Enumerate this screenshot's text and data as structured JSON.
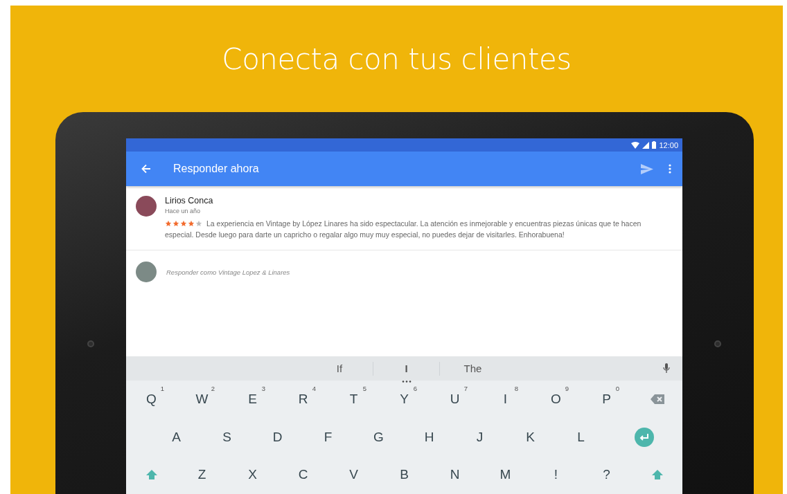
{
  "headline": "Conecta con tus clientes",
  "status_bar": {
    "time": "12:00"
  },
  "app_bar": {
    "title": "Responder ahora"
  },
  "review": {
    "author": "Lirios Conca",
    "date": "Hace un año",
    "stars": 4,
    "text": "La experiencia en Vintage by López Linares ha sido espectacular. La atención es inmejorable y encuentras piezas únicas que te hacen especial. Desde luego para darte un capricho o regalar algo muy muy especial, no puedes dejar de visitarles. Enhorabuena!"
  },
  "reply": {
    "placeholder": "Responder como Vintage Lopez & Linares"
  },
  "keyboard": {
    "suggestions": [
      {
        "label": "If",
        "selected": false
      },
      {
        "label": "I",
        "selected": true
      },
      {
        "label": "The",
        "selected": false
      }
    ],
    "rows": [
      [
        {
          "kind": "letter",
          "label": "Q",
          "hint": "1"
        },
        {
          "kind": "letter",
          "label": "W",
          "hint": "2"
        },
        {
          "kind": "letter",
          "label": "E",
          "hint": "3"
        },
        {
          "kind": "letter",
          "label": "R",
          "hint": "4"
        },
        {
          "kind": "letter",
          "label": "T",
          "hint": "5"
        },
        {
          "kind": "letter",
          "label": "Y",
          "hint": "6"
        },
        {
          "kind": "letter",
          "label": "U",
          "hint": "7"
        },
        {
          "kind": "letter",
          "label": "I",
          "hint": "8"
        },
        {
          "kind": "letter",
          "label": "O",
          "hint": "9"
        },
        {
          "kind": "letter",
          "label": "P",
          "hint": "0"
        },
        {
          "kind": "backspace"
        }
      ],
      [
        {
          "kind": "letter",
          "label": "A"
        },
        {
          "kind": "letter",
          "label": "S"
        },
        {
          "kind": "letter",
          "label": "D"
        },
        {
          "kind": "letter",
          "label": "F"
        },
        {
          "kind": "letter",
          "label": "G"
        },
        {
          "kind": "letter",
          "label": "H"
        },
        {
          "kind": "letter",
          "label": "J"
        },
        {
          "kind": "letter",
          "label": "K"
        },
        {
          "kind": "letter",
          "label": "L"
        },
        {
          "kind": "enter"
        }
      ],
      [
        {
          "kind": "shift"
        },
        {
          "kind": "letter",
          "label": "Z"
        },
        {
          "kind": "letter",
          "label": "X"
        },
        {
          "kind": "letter",
          "label": "C"
        },
        {
          "kind": "letter",
          "label": "V"
        },
        {
          "kind": "letter",
          "label": "B"
        },
        {
          "kind": "letter",
          "label": "N"
        },
        {
          "kind": "letter",
          "label": "M"
        },
        {
          "kind": "letter",
          "label": "!"
        },
        {
          "kind": "letter",
          "label": "?"
        },
        {
          "kind": "shift"
        }
      ]
    ]
  }
}
